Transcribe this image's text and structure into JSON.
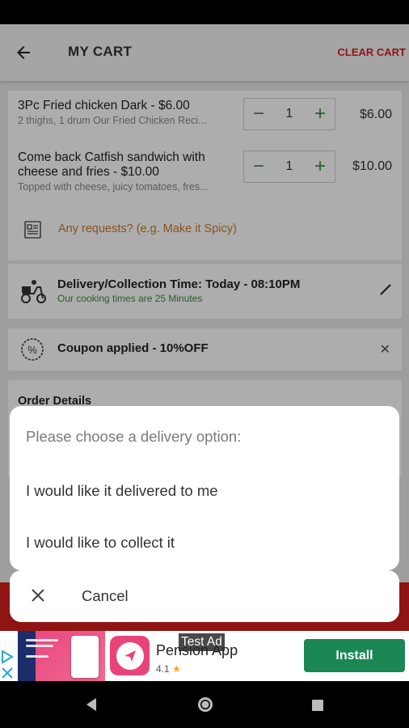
{
  "toolbar": {
    "title": "MY CART",
    "clear_label": "CLEAR CART"
  },
  "cart": {
    "items": [
      {
        "name": "3Pc Fried chicken Dark - $6.00",
        "description": "2 thighs, 1 drum Our Fried Chicken Reci...",
        "quantity": "1",
        "price": "$6.00"
      },
      {
        "name": "Come back Catfish sandwich with cheese and fries - $10.00",
        "description": "Topped with cheese, juicy tomatoes, fres...",
        "quantity": "1",
        "price": "$10.00"
      }
    ],
    "requests_placeholder": "Any requests? (e.g. Make it Spicy)"
  },
  "delivery": {
    "title": "Delivery/Collection Time: Today - 08:10PM",
    "subtitle": "Our cooking times are 25 Minutes"
  },
  "coupon": {
    "text": "Coupon applied - 10%OFF"
  },
  "order_details": {
    "title": "Order Details"
  },
  "dialog": {
    "prompt": "Please choose a delivery option:",
    "options": [
      "I would like it delivered to me",
      "I would like to collect it"
    ],
    "cancel_label": "Cancel"
  },
  "ad": {
    "badge": "Test Ad",
    "app_name": "Pension App",
    "rating": "4.1",
    "star": "★",
    "install_label": "Install"
  },
  "colors": {
    "accent_red": "#d32020",
    "accent_green": "#3a8f3a",
    "install_green": "#1a8754",
    "request_orange": "#c67a2e"
  }
}
